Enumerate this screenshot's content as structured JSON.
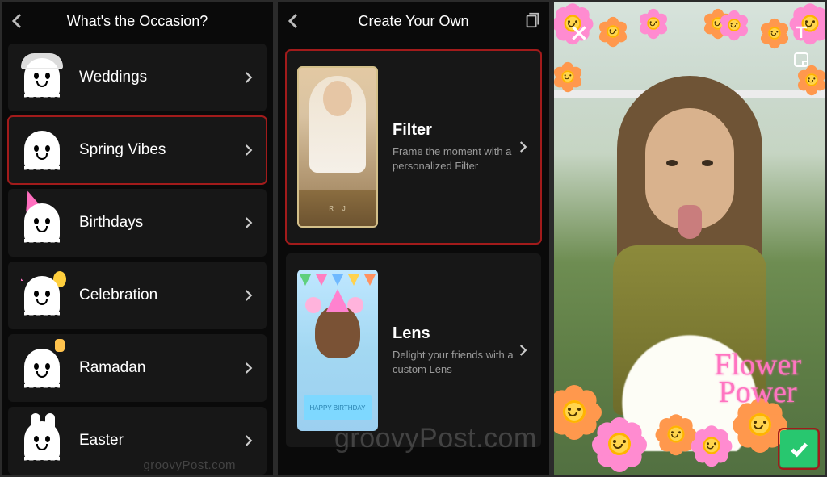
{
  "screens": {
    "occasion": {
      "title": "What's the Occasion?",
      "items": [
        {
          "label": "Weddings",
          "icon": "ghost-wedding",
          "selected": false
        },
        {
          "label": "Spring Vibes",
          "icon": "ghost-spring",
          "selected": true
        },
        {
          "label": "Birthdays",
          "icon": "ghost-birthday",
          "selected": false
        },
        {
          "label": "Celebration",
          "icon": "ghost-party",
          "selected": false
        },
        {
          "label": "Ramadan",
          "icon": "ghost-ramadan",
          "selected": false
        },
        {
          "label": "Easter",
          "icon": "ghost-easter",
          "selected": false
        }
      ]
    },
    "create": {
      "title": "Create Your Own",
      "items": [
        {
          "title": "Filter",
          "subtitle": "Frame the moment with a personalized Filter",
          "selected": true
        },
        {
          "title": "Lens",
          "subtitle": "Delight your friends with a custom Lens",
          "selected": false
        }
      ]
    },
    "preview": {
      "filter_text_line1": "Flower",
      "filter_text_line2": "Power",
      "confirm_icon": "checkmark"
    }
  },
  "watermark": "groovyPost.com"
}
